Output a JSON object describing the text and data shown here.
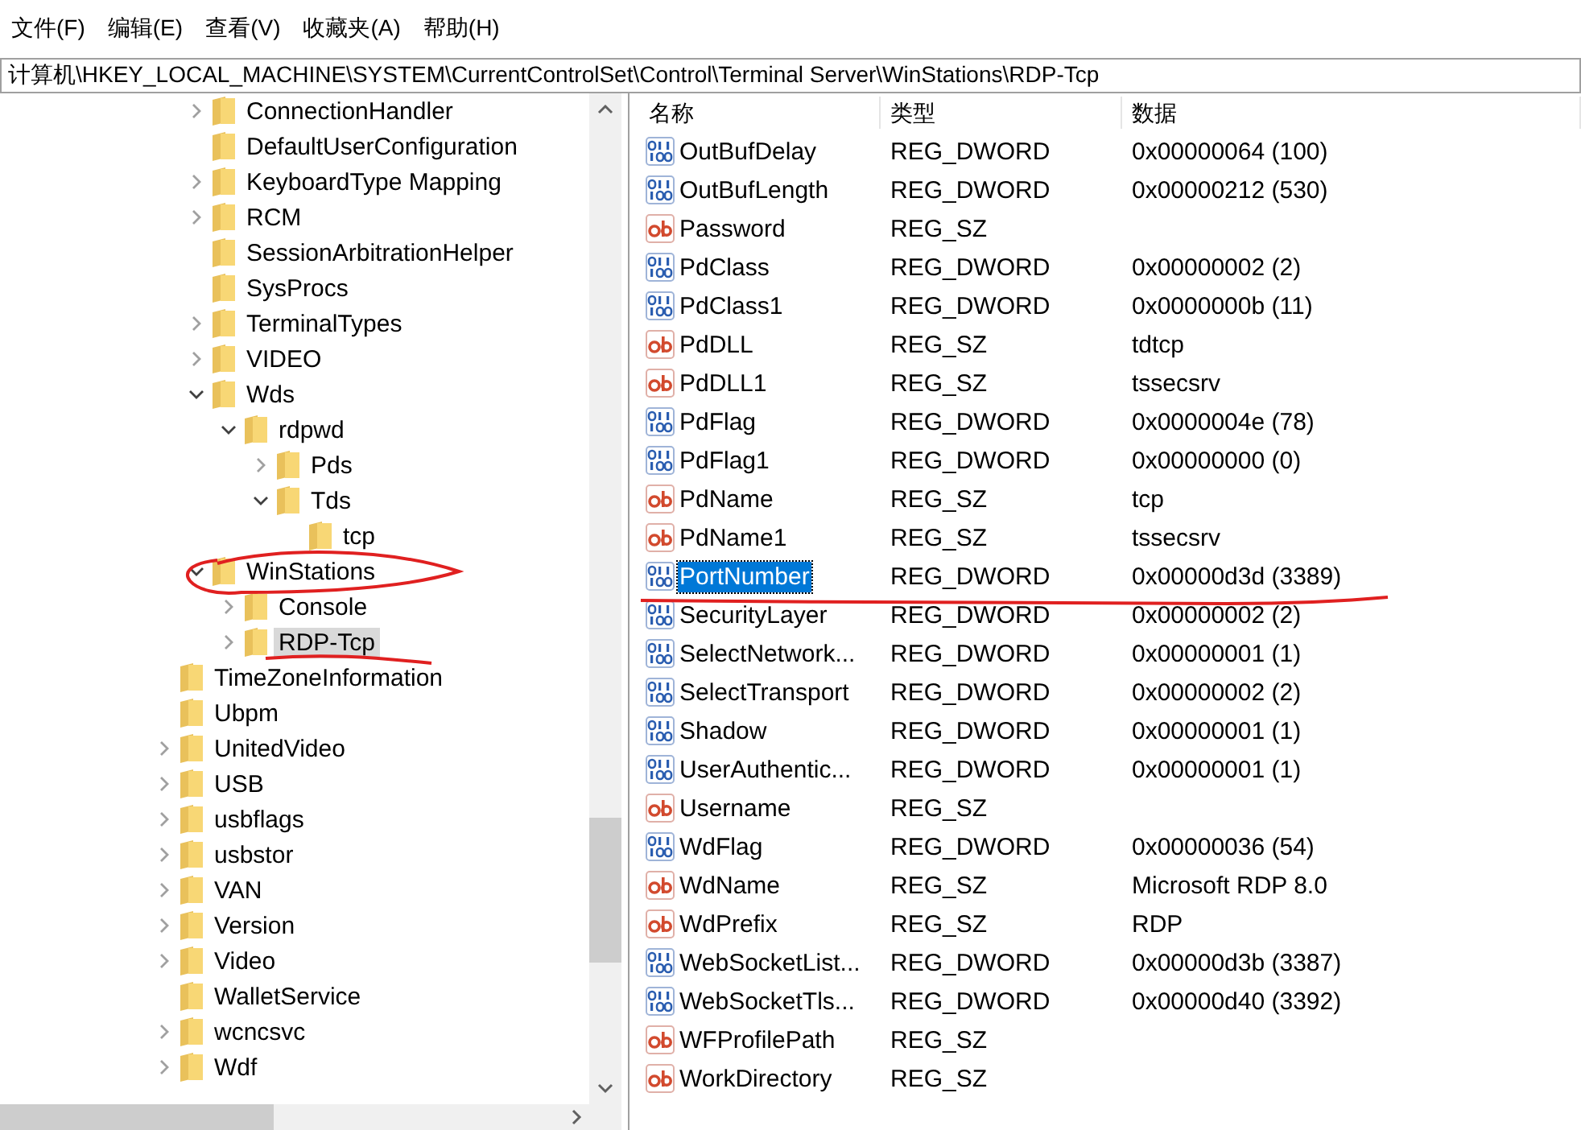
{
  "menu": [
    "文件(F)",
    "编辑(E)",
    "查看(V)",
    "收藏夹(A)",
    "帮助(H)"
  ],
  "address": "计算机\\HKEY_LOCAL_MACHINE\\SYSTEM\\CurrentControlSet\\Control\\Terminal Server\\WinStations\\RDP-Tcp",
  "tree": {
    "items": [
      {
        "children": [
          {
            "label": "ConnectionHandler",
            "expanded": false,
            "selected": false
          },
          {
            "label": "DefaultUserConfiguration",
            "selected": false
          },
          {
            "label": "KeyboardType Mapping",
            "expanded": false,
            "selected": false
          },
          {
            "label": "RCM",
            "expanded": false,
            "selected": false
          },
          {
            "label": "SessionArbitrationHelper",
            "selected": false
          },
          {
            "label": "SysProcs",
            "selected": false
          },
          {
            "label": "TerminalTypes",
            "expanded": false,
            "selected": false
          },
          {
            "label": "VIDEO",
            "expanded": false,
            "selected": false
          },
          {
            "label": "Wds",
            "expanded": true,
            "selected": false,
            "children": [
              {
                "label": "rdpwd",
                "expanded": true,
                "selected": false,
                "children": [
                  {
                    "label": "Pds",
                    "expanded": false,
                    "selected": false
                  },
                  {
                    "label": "Tds",
                    "expanded": true,
                    "selected": false,
                    "children": [
                      {
                        "label": "tcp",
                        "selected": false
                      }
                    ]
                  }
                ]
              }
            ]
          },
          {
            "label": "WinStations",
            "expanded": true,
            "selected": false,
            "children": [
              {
                "label": "Console",
                "expanded": false,
                "selected": false
              },
              {
                "label": "RDP-Tcp",
                "expanded": false,
                "selected": true
              }
            ]
          }
        ]
      },
      {
        "label": "TimeZoneInformation",
        "selected": false
      },
      {
        "label": "Ubpm",
        "selected": false
      },
      {
        "label": "UnitedVideo",
        "expanded": false,
        "selected": false
      },
      {
        "label": "USB",
        "expanded": false,
        "selected": false
      },
      {
        "label": "usbflags",
        "expanded": false,
        "selected": false
      },
      {
        "label": "usbstor",
        "expanded": false,
        "selected": false
      },
      {
        "label": "VAN",
        "expanded": false,
        "selected": false
      },
      {
        "label": "Version",
        "expanded": false,
        "selected": false
      },
      {
        "label": "Video",
        "expanded": false,
        "selected": false
      },
      {
        "label": "WalletService",
        "selected": false
      },
      {
        "label": "wcncsvc",
        "expanded": false,
        "selected": false
      },
      {
        "label": "Wdf",
        "expanded": false,
        "selected": false
      }
    ]
  },
  "values": {
    "columns": [
      "名称",
      "类型",
      "数据"
    ],
    "rows": [
      {
        "kind": "dword",
        "name": "OutBufDelay",
        "type": "REG_DWORD",
        "data": "0x00000064 (100)",
        "selected": false
      },
      {
        "kind": "dword",
        "name": "OutBufLength",
        "type": "REG_DWORD",
        "data": "0x00000212 (530)",
        "selected": false
      },
      {
        "kind": "sz",
        "name": "Password",
        "type": "REG_SZ",
        "selected": false
      },
      {
        "kind": "dword",
        "name": "PdClass",
        "type": "REG_DWORD",
        "data": "0x00000002 (2)",
        "selected": false
      },
      {
        "kind": "dword",
        "name": "PdClass1",
        "type": "REG_DWORD",
        "data": "0x0000000b (11)",
        "selected": false
      },
      {
        "kind": "sz",
        "name": "PdDLL",
        "type": "REG_SZ",
        "data": "tdtcp",
        "selected": false
      },
      {
        "kind": "sz",
        "name": "PdDLL1",
        "type": "REG_SZ",
        "data": "tssecsrv",
        "selected": false
      },
      {
        "kind": "dword",
        "name": "PdFlag",
        "type": "REG_DWORD",
        "data": "0x0000004e (78)",
        "selected": false
      },
      {
        "kind": "dword",
        "name": "PdFlag1",
        "type": "REG_DWORD",
        "data": "0x00000000 (0)",
        "selected": false
      },
      {
        "kind": "sz",
        "name": "PdName",
        "type": "REG_SZ",
        "data": "tcp",
        "selected": false
      },
      {
        "kind": "sz",
        "name": "PdName1",
        "type": "REG_SZ",
        "data": "tssecsrv",
        "selected": false
      },
      {
        "kind": "dword",
        "name": "PortNumber",
        "type": "REG_DWORD",
        "data": "0x00000d3d (3389)",
        "selected": true
      },
      {
        "kind": "dword",
        "name": "SecurityLayer",
        "type": "REG_DWORD",
        "data": "0x00000002 (2)",
        "selected": false
      },
      {
        "kind": "dword",
        "name": "SelectNetwork...",
        "type": "REG_DWORD",
        "data": "0x00000001 (1)",
        "selected": false
      },
      {
        "kind": "dword",
        "name": "SelectTransport",
        "type": "REG_DWORD",
        "data": "0x00000002 (2)",
        "selected": false
      },
      {
        "kind": "dword",
        "name": "Shadow",
        "type": "REG_DWORD",
        "data": "0x00000001 (1)",
        "selected": false
      },
      {
        "kind": "dword",
        "name": "UserAuthentic...",
        "type": "REG_DWORD",
        "data": "0x00000001 (1)",
        "selected": false
      },
      {
        "kind": "sz",
        "name": "Username",
        "type": "REG_SZ",
        "selected": false
      },
      {
        "kind": "dword",
        "name": "WdFlag",
        "type": "REG_DWORD",
        "data": "0x00000036 (54)",
        "selected": false
      },
      {
        "kind": "sz",
        "name": "WdName",
        "type": "REG_SZ",
        "data": "Microsoft RDP 8.0",
        "selected": false
      },
      {
        "kind": "sz",
        "name": "WdPrefix",
        "type": "REG_SZ",
        "data": "RDP",
        "selected": false
      },
      {
        "kind": "dword",
        "name": "WebSocketList...",
        "type": "REG_DWORD",
        "data": "0x00000d3b (3387)",
        "selected": false
      },
      {
        "kind": "dword",
        "name": "WebSocketTls...",
        "type": "REG_DWORD",
        "data": "0x00000d40 (3392)",
        "selected": false
      },
      {
        "kind": "sz",
        "name": "WFProfilePath",
        "type": "REG_SZ",
        "selected": false
      },
      {
        "kind": "sz",
        "name": "WorkDirectory",
        "type": "REG_SZ",
        "selected": false
      }
    ]
  }
}
